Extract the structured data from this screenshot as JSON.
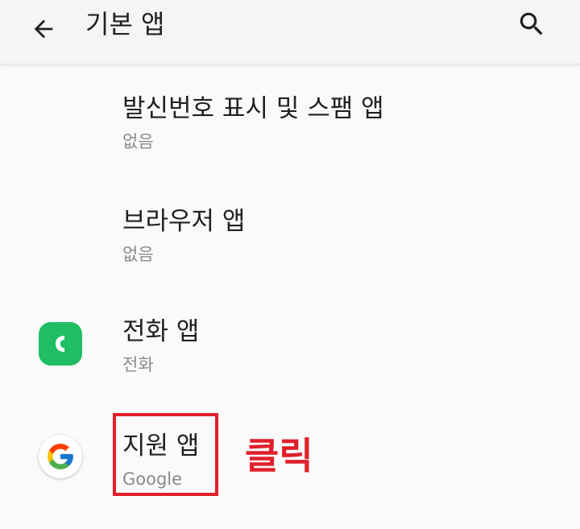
{
  "appbar": {
    "title": "기본 앱",
    "back_icon": "arrow-back-icon",
    "search_icon": "search-icon"
  },
  "items": [
    {
      "title": "발신번호 표시 및 스팸 앱",
      "subtitle": "없음",
      "icon": ""
    },
    {
      "title": "브라우저 앱",
      "subtitle": "없음",
      "icon": ""
    },
    {
      "title": "전화 앱",
      "subtitle": "전화",
      "icon": "phone-app-icon"
    },
    {
      "title": "지원 앱",
      "subtitle": "Google",
      "icon": "google-icon"
    }
  ],
  "annotation": {
    "label": "클릭",
    "color": "#e0202a"
  },
  "colors": {
    "phone_green": "#1fbe63",
    "text_primary": "#212121",
    "text_secondary": "#8a8a8a"
  }
}
